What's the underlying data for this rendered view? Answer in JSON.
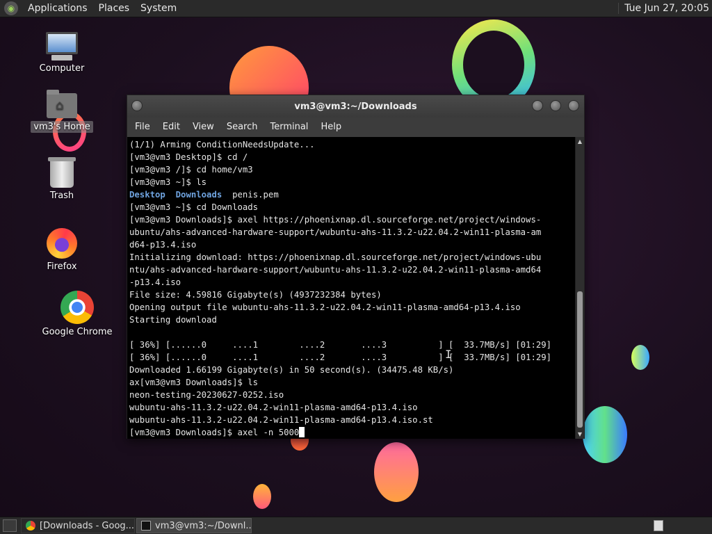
{
  "top_panel": {
    "menus": [
      "Applications",
      "Places",
      "System"
    ],
    "clock": "Tue Jun 27, 20:05"
  },
  "desktop_icons": [
    {
      "label": "Computer",
      "icon": "computer-icon"
    },
    {
      "label": "vm3's Home",
      "icon": "home-folder-icon"
    },
    {
      "label": "Trash",
      "icon": "trash-icon"
    },
    {
      "label": "Firefox",
      "icon": "firefox-icon"
    },
    {
      "label": "Google Chrome",
      "icon": "chrome-icon"
    }
  ],
  "terminal": {
    "title": "vm3@vm3:~/Downloads",
    "menu": [
      "File",
      "Edit",
      "View",
      "Search",
      "Terminal",
      "Help"
    ],
    "lines": [
      "(1/1) Arming ConditionNeedsUpdate...",
      "[vm3@vm3 Desktop]$ cd /",
      "[vm3@vm3 /]$ cd home/vm3",
      "[vm3@vm3 ~]$ ls",
      "",
      "[vm3@vm3 ~]$ cd Downloads",
      "[vm3@vm3 Downloads]$ axel https://phoenixnap.dl.sourceforge.net/project/windows-",
      "ubuntu/ahs-advanced-hardware-support/wubuntu-ahs-11.3.2-u22.04.2-win11-plasma-am",
      "d64-p13.4.iso",
      "Initializing download: https://phoenixnap.dl.sourceforge.net/project/windows-ubu",
      "ntu/ahs-advanced-hardware-support/wubuntu-ahs-11.3.2-u22.04.2-win11-plasma-amd64",
      "-p13.4.iso",
      "File size: 4.59816 Gigabyte(s) (4937232384 bytes)",
      "Opening output file wubuntu-ahs-11.3.2-u22.04.2-win11-plasma-amd64-p13.4.iso",
      "Starting download",
      "",
      "[ 36%] [......0     ....1        ....2       ....3          ] [  33.7MB/s] [01:29]",
      "[ 36%] [......0     ....1        ....2       ....3          ] [  33.7MB/s] [01:29]",
      "Downloaded 1.66199 Gigabyte(s) in 50 second(s). (34475.48 KB/s)",
      "ax[vm3@vm3 Downloads]$ ls",
      "neon-testing-20230627-0252.iso",
      "wubuntu-ahs-11.3.2-u22.04.2-win11-plasma-amd64-p13.4.iso",
      "wubuntu-ahs-11.3.2-u22.04.2-win11-plasma-amd64-p13.4.iso.st"
    ],
    "ls_output": {
      "dir1": "Desktop",
      "dir2": "Downloads",
      "file": "penis.pem"
    },
    "prompt_line": "[vm3@vm3 Downloads]$ axel -n 5000"
  },
  "taskbar": {
    "tasks": [
      {
        "label": "[Downloads - Goog...",
        "icon": "chrome-icon"
      },
      {
        "label": "vm3@vm3:~/Downl...",
        "icon": "terminal-icon"
      }
    ]
  },
  "colors": {
    "directory": "#6fa3df",
    "terminal_bg": "#000000",
    "panel_bg": "#2a2a2a"
  }
}
